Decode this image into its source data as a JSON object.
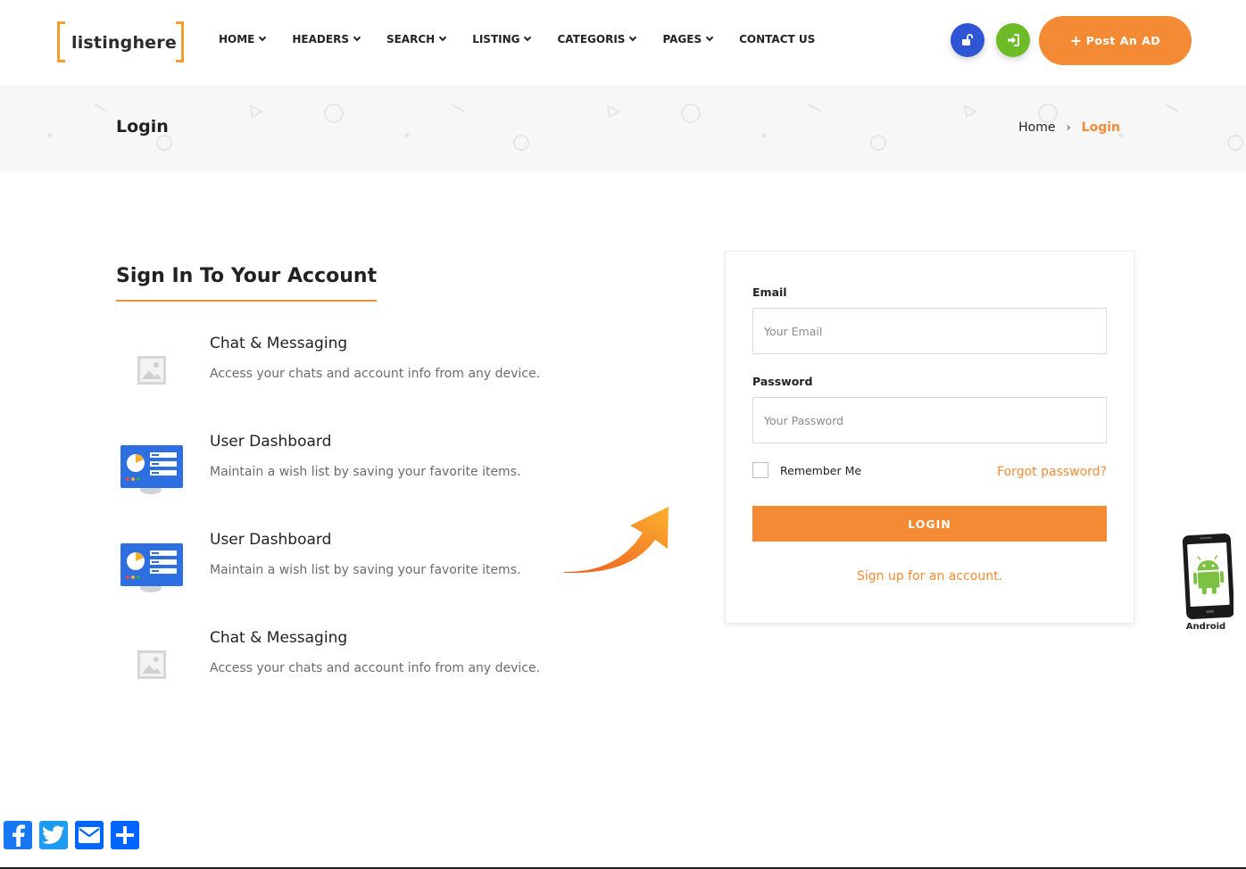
{
  "header": {
    "logo_text": "listinghere",
    "nav": [
      {
        "label": "HOME",
        "has_dropdown": true
      },
      {
        "label": "HEADERS",
        "has_dropdown": true
      },
      {
        "label": "SEARCH",
        "has_dropdown": true
      },
      {
        "label": "LISTING",
        "has_dropdown": true
      },
      {
        "label": "CATEGORIS",
        "has_dropdown": true
      },
      {
        "label": "PAGES",
        "has_dropdown": true
      },
      {
        "label": "CONTACT US",
        "has_dropdown": false
      }
    ],
    "register_icon": "unlock-icon",
    "login_icon": "sign-in-icon",
    "post_ad_label": "Post An AD"
  },
  "titlebar": {
    "title": "Login",
    "breadcrumb": {
      "home": "Home",
      "current": "Login"
    }
  },
  "left": {
    "heading": "Sign In To Your Account",
    "features": [
      {
        "title": "Chat & Messaging",
        "description": "Access your chats and account info from any device.",
        "icon": "image-placeholder-icon"
      },
      {
        "title": "User Dashboard",
        "description": "Maintain a wish list by saving your favorite items.",
        "icon": "dashboard-icon"
      },
      {
        "title": "User Dashboard",
        "description": "Maintain a wish list by saving your favorite items.",
        "icon": "dashboard-icon"
      },
      {
        "title": "Chat & Messaging",
        "description": "Access your chats and account info from any device.",
        "icon": "image-placeholder-icon"
      }
    ]
  },
  "login_form": {
    "email_label": "Email",
    "email_placeholder": "Your Email",
    "email_value": "",
    "password_label": "Password",
    "password_placeholder": "Your Password",
    "password_value": "",
    "remember_label": "Remember Me",
    "remember_checked": false,
    "forgot_label": "Forgot password?",
    "submit_label": "LOGIN",
    "signup_label": "Sign up for an account."
  },
  "android_badge": {
    "label": "Android"
  },
  "share": [
    {
      "name": "facebook-icon",
      "color": "#1877f2"
    },
    {
      "name": "twitter-icon",
      "color": "#1d9bf0"
    },
    {
      "name": "email-icon",
      "color": "#0166ff"
    },
    {
      "name": "share-icon",
      "color": "#0166ff"
    }
  ],
  "colors": {
    "accent": "#f58a34",
    "blue": "#2d55d4",
    "green": "#6dbb27"
  }
}
